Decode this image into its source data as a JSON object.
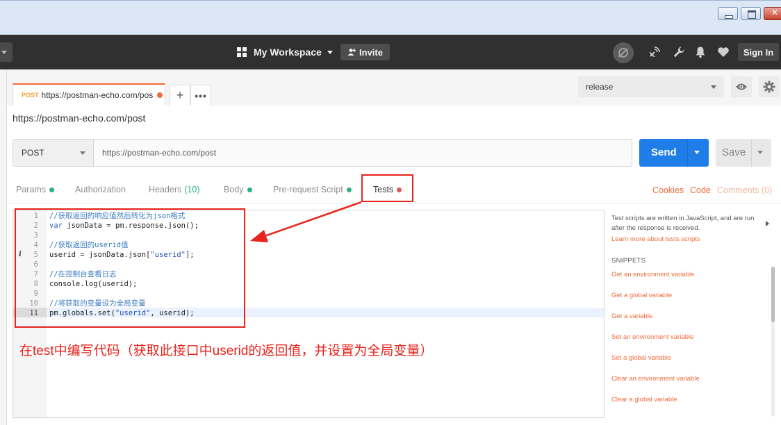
{
  "header": {
    "workspace": "My Workspace",
    "invite": "Invite",
    "signin": "Sign In"
  },
  "tabs": {
    "active": {
      "method": "POST",
      "url": "https://postman-echo.com/pos"
    }
  },
  "environment": {
    "selected": "release"
  },
  "request": {
    "name": "https://postman-echo.com/post",
    "method": "POST",
    "url": "https://postman-echo.com/post",
    "send": "Send",
    "save": "Save"
  },
  "subtabs": {
    "params": "Params",
    "authorization": "Authorization",
    "headers": "Headers",
    "headers_count": "(10)",
    "body": "Body",
    "prerequest": "Pre-request Script",
    "tests": "Tests",
    "cookies": "Cookies",
    "code": "Code",
    "comments": "Comments (0)"
  },
  "editor": {
    "line_numbers": [
      "1",
      "2",
      "3",
      "4",
      "5",
      "6",
      "7",
      "8",
      "9",
      "10",
      "11"
    ],
    "l1": "//获取返回的响应值然后转化为json格式",
    "l2_kw": "var",
    "l2_rest": " jsonData = pm.response.json();",
    "l4": "//获取返回的userid值",
    "l5_a": "userid = jsonData.json[",
    "l5_str": "\"userid\"",
    "l5_b": "];",
    "l7": "//在控制台查看日志",
    "l8": "console.log(userid);",
    "l10": "//将获取的变量设为全局变量",
    "l11_a": "pm.globals.set(",
    "l11_str": "\"userid\"",
    "l11_b": ", userid);",
    "info_marker": "i"
  },
  "annotation": "在test中编写代码（获取此接口中userid的返回值，并设置为全局变量）",
  "sidepanel": {
    "description": "Test scripts are written in JavaScript, and are run after the response is received.",
    "learn": "Learn more about tests scripts",
    "heading": "SNIPPETS",
    "snippets": [
      "Get an environment variable",
      "Get a global variable",
      "Get a variable",
      "Set an environment variable",
      "Set a global variable",
      "Clear an environment variable",
      "Clear a global variable"
    ]
  },
  "colors": {
    "accent": "#f26b3a",
    "send": "#1f7de8",
    "annotation_red": "#e8231b",
    "status_green": "#2ab27b"
  },
  "icons": [
    "grid-icon",
    "add-person-icon",
    "sync-off-icon",
    "satellite-icon",
    "wrench-icon",
    "bell-icon",
    "heart-icon",
    "eye-icon",
    "gear-icon",
    "chevron-down-icon"
  ]
}
